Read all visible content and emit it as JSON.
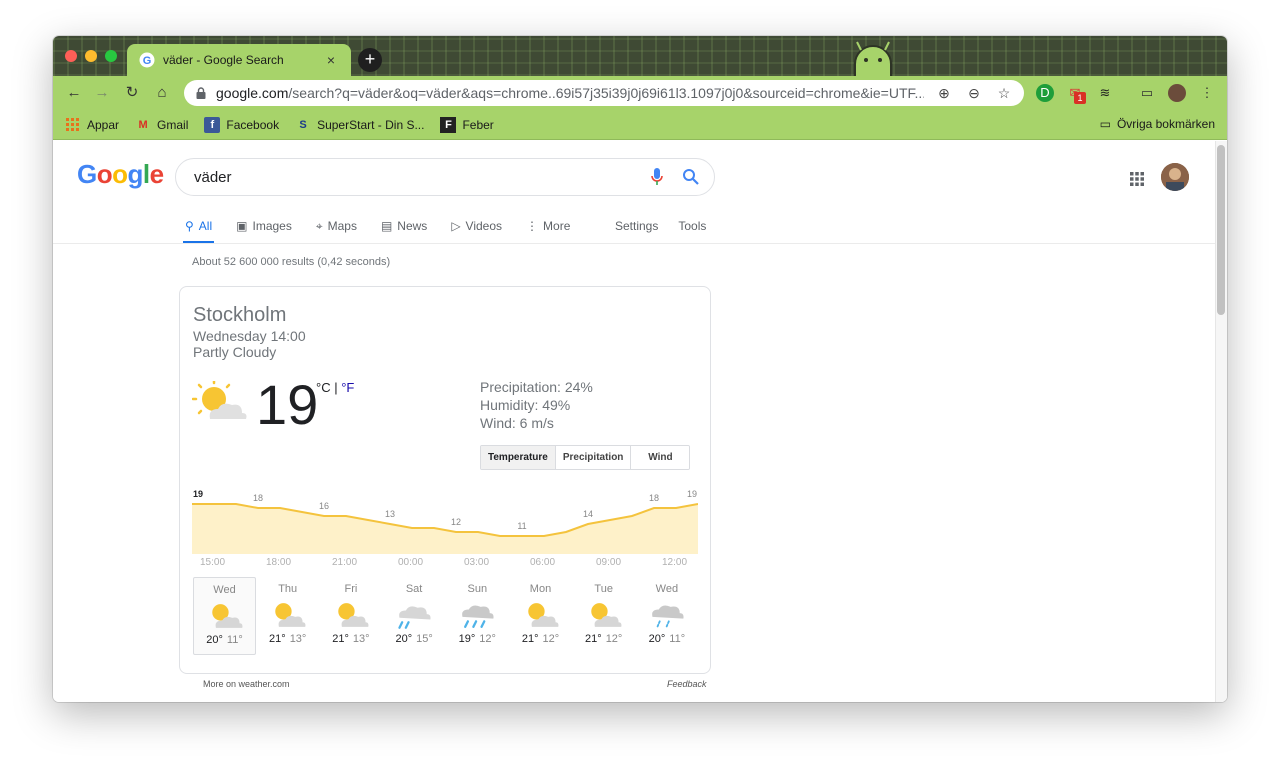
{
  "browser": {
    "tab_title": "väder - Google Search",
    "tab_close": "×",
    "new_tab": "+",
    "url_host": "google.com",
    "url_path": "/search?q=väder&oq=väder&aqs=chrome..69i57j35i39j0j69i61l3.1097j0j0&sourceid=chrome&ie=UTF...",
    "gmail_badge": "1",
    "bookmarks": [
      {
        "label": "Appar",
        "icon": "apps-icon"
      },
      {
        "label": "Gmail",
        "icon": "gmail-icon"
      },
      {
        "label": "Facebook",
        "icon": "facebook-icon"
      },
      {
        "label": "SuperStart - Din S...",
        "icon": "superstart-icon"
      },
      {
        "label": "Feber",
        "icon": "feber-icon"
      }
    ],
    "other_bookmarks": "Övriga bokmärken"
  },
  "search": {
    "logo": "Google",
    "query": "väder",
    "tabs": [
      {
        "label": "All",
        "icon": "search-icon"
      },
      {
        "label": "Images",
        "icon": "image-icon"
      },
      {
        "label": "Maps",
        "icon": "map-icon"
      },
      {
        "label": "News",
        "icon": "news-icon"
      },
      {
        "label": "Videos",
        "icon": "video-icon"
      },
      {
        "label": "More",
        "icon": "more-vert-icon"
      }
    ],
    "settings": "Settings",
    "tools": "Tools",
    "results_count": "About 52 600 000 results (0,42 seconds)"
  },
  "weather": {
    "city": "Stockholm",
    "when": "Wednesday 14:00",
    "condition": "Partly Cloudy",
    "temp": "19",
    "unit_c": "°C",
    "unit_sep": " | ",
    "unit_f": "°F",
    "precipitation": "Precipitation: 24%",
    "humidity": "Humidity: 49%",
    "wind": "Wind: 6 m/s",
    "segments": [
      "Temperature",
      "Precipitation",
      "Wind"
    ],
    "more_link": "More on weather.com",
    "feedback": "Feedback",
    "forecast": [
      {
        "day": "Wed",
        "hi": "20°",
        "lo": "11°",
        "icon": "partly-cloudy-icon"
      },
      {
        "day": "Thu",
        "hi": "21°",
        "lo": "13°",
        "icon": "partly-cloudy-icon"
      },
      {
        "day": "Fri",
        "hi": "21°",
        "lo": "13°",
        "icon": "partly-cloudy-icon"
      },
      {
        "day": "Sat",
        "hi": "20°",
        "lo": "15°",
        "icon": "scattered-showers-icon"
      },
      {
        "day": "Sun",
        "hi": "19°",
        "lo": "12°",
        "icon": "rain-icon"
      },
      {
        "day": "Mon",
        "hi": "21°",
        "lo": "12°",
        "icon": "partly-cloudy-icon"
      },
      {
        "day": "Tue",
        "hi": "21°",
        "lo": "12°",
        "icon": "partly-cloudy-icon"
      },
      {
        "day": "Wed",
        "hi": "20°",
        "lo": "11°",
        "icon": "light-rain-icon"
      }
    ]
  },
  "chart_data": {
    "type": "area",
    "x": [
      "14:00",
      "15:00",
      "16:00",
      "17:00",
      "18:00",
      "19:00",
      "20:00",
      "21:00",
      "22:00",
      "23:00",
      "00:00",
      "01:00",
      "02:00",
      "03:00",
      "04:00",
      "05:00",
      "06:00",
      "07:00",
      "08:00",
      "09:00",
      "10:00",
      "11:00",
      "12:00",
      "13:00"
    ],
    "values": [
      19,
      19,
      19,
      18,
      18,
      17,
      16,
      16,
      15,
      14,
      13,
      13,
      12,
      12,
      11,
      11,
      11,
      12,
      14,
      15,
      16,
      18,
      18,
      19
    ],
    "value_labels": [
      "19",
      "18",
      "16",
      "13",
      "12",
      "11",
      "14",
      "18",
      "19"
    ],
    "tick_labels": [
      "15:00",
      "18:00",
      "21:00",
      "00:00",
      "03:00",
      "06:00",
      "09:00",
      "12:00"
    ],
    "ylabel": "",
    "colors": {
      "line": "#f4c33d",
      "fill": "#fef1c9"
    }
  }
}
